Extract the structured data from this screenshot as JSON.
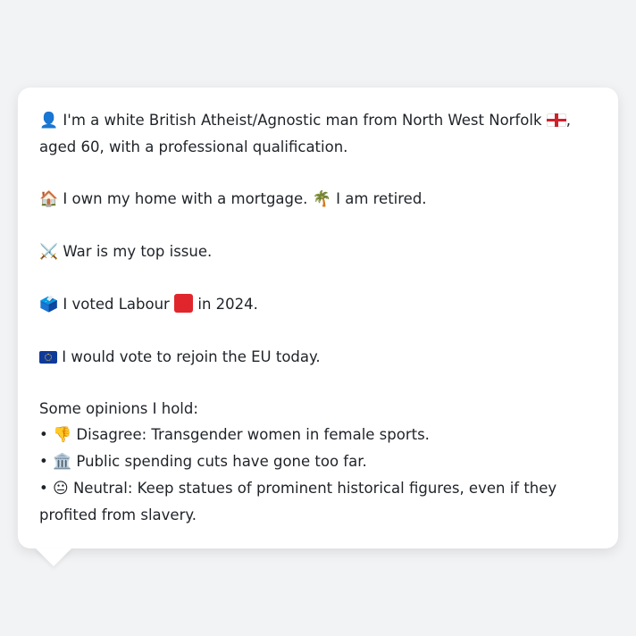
{
  "profile": {
    "identity": {
      "icon": "person-silhouette-icon",
      "text_a": "I'm a white British Atheist/Agnostic man from North West Norfolk",
      "flag": "england-flag-icon",
      "text_b": ",",
      "text_c": "aged 60, with a professional qualification."
    },
    "housing": {
      "icon": "house-icon",
      "text_a": "I own my home with a mortgage.",
      "icon2": "palm-tree-icon",
      "text_b": "I am retired."
    },
    "issue": {
      "icon": "crossed-swords-icon",
      "text": "War is my top issue."
    },
    "vote": {
      "icon": "ballot-box-icon",
      "text_a": "I voted Labour",
      "party_color": "#e0262c",
      "text_b": "in 2024."
    },
    "eu": {
      "icon": "eu-flag-icon",
      "text": "I would vote to rejoin the EU today."
    },
    "opinions": {
      "heading": "Some opinions I hold:",
      "items": [
        {
          "bullet": "•",
          "icon": "thumbs-down-icon",
          "glyph": "👎",
          "text": "Disagree: Transgender women in female sports."
        },
        {
          "bullet": "•",
          "icon": "classical-building-icon",
          "glyph": "🏛️",
          "text": "Public spending cuts have gone too far."
        },
        {
          "bullet": "•",
          "icon": "neutral-face-icon",
          "glyph": "😐",
          "text": "Neutral: Keep statues of prominent historical figures, even if they profited from slavery."
        }
      ]
    }
  }
}
